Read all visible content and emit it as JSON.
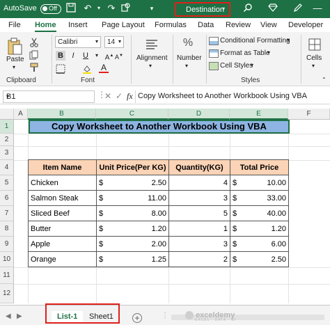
{
  "titlebar": {
    "autosave_label": "AutoSave",
    "autosave_state": "Off",
    "workbook_name": "Destination"
  },
  "tabs": [
    "File",
    "Home",
    "Insert",
    "Page Layout",
    "Formulas",
    "Data",
    "Review",
    "View",
    "Developer"
  ],
  "active_tab": "Home",
  "ribbon": {
    "paste_label": "Paste",
    "clipboard_label": "Clipboard",
    "font_name": "Calibri",
    "font_size": "14",
    "font_label": "Font",
    "bold": "B",
    "italic": "I",
    "underline": "U",
    "alignment_label": "Alignment",
    "number_label": "Number",
    "number_symbol": "%",
    "conditional_formatting": "Conditional Formatting",
    "format_as_table": "Format as Table",
    "cell_styles": "Cell Styles",
    "styles_label": "Styles",
    "cells_label": "Cells"
  },
  "formula_bar": {
    "name_box": "B1",
    "fx": "fx",
    "content": "Copy Worksheet to Another Workbook Using VBA"
  },
  "columns": [
    "A",
    "B",
    "C",
    "D",
    "E",
    "F"
  ],
  "rows": [
    "1",
    "2",
    "3",
    "4",
    "5",
    "6",
    "7",
    "8",
    "9",
    "10",
    "11",
    "12"
  ],
  "sheet": {
    "title": "Copy Worksheet to Another Workbook Using VBA",
    "headers": [
      "Item Name",
      "Unit Price(Per KG)",
      "Quantity(KG)",
      "Total Price"
    ],
    "currency": "$",
    "items": [
      {
        "name": "Chicken",
        "price": "2.50",
        "qty": "4",
        "total": "10.00"
      },
      {
        "name": "Salmon Steak",
        "price": "11.00",
        "qty": "3",
        "total": "33.00"
      },
      {
        "name": "Sliced Beef",
        "price": "8.00",
        "qty": "5",
        "total": "40.00"
      },
      {
        "name": "Butter",
        "price": "1.20",
        "qty": "1",
        "total": "1.20"
      },
      {
        "name": "Apple",
        "price": "2.00",
        "qty": "3",
        "total": "6.00"
      },
      {
        "name": "Orange",
        "price": "1.25",
        "qty": "2",
        "total": "2.50"
      }
    ]
  },
  "sheet_tabs": [
    "List-1",
    "Sheet1"
  ],
  "active_sheet": "List-1",
  "watermark": {
    "name": "exceldemy",
    "tagline": "EXCEL · DATA · BI"
  },
  "colors": {
    "excel_green": "#1e7145",
    "header_fill": "#fbd3b6",
    "title_fill": "#8db4e2",
    "highlight_red": "#e0201b"
  }
}
